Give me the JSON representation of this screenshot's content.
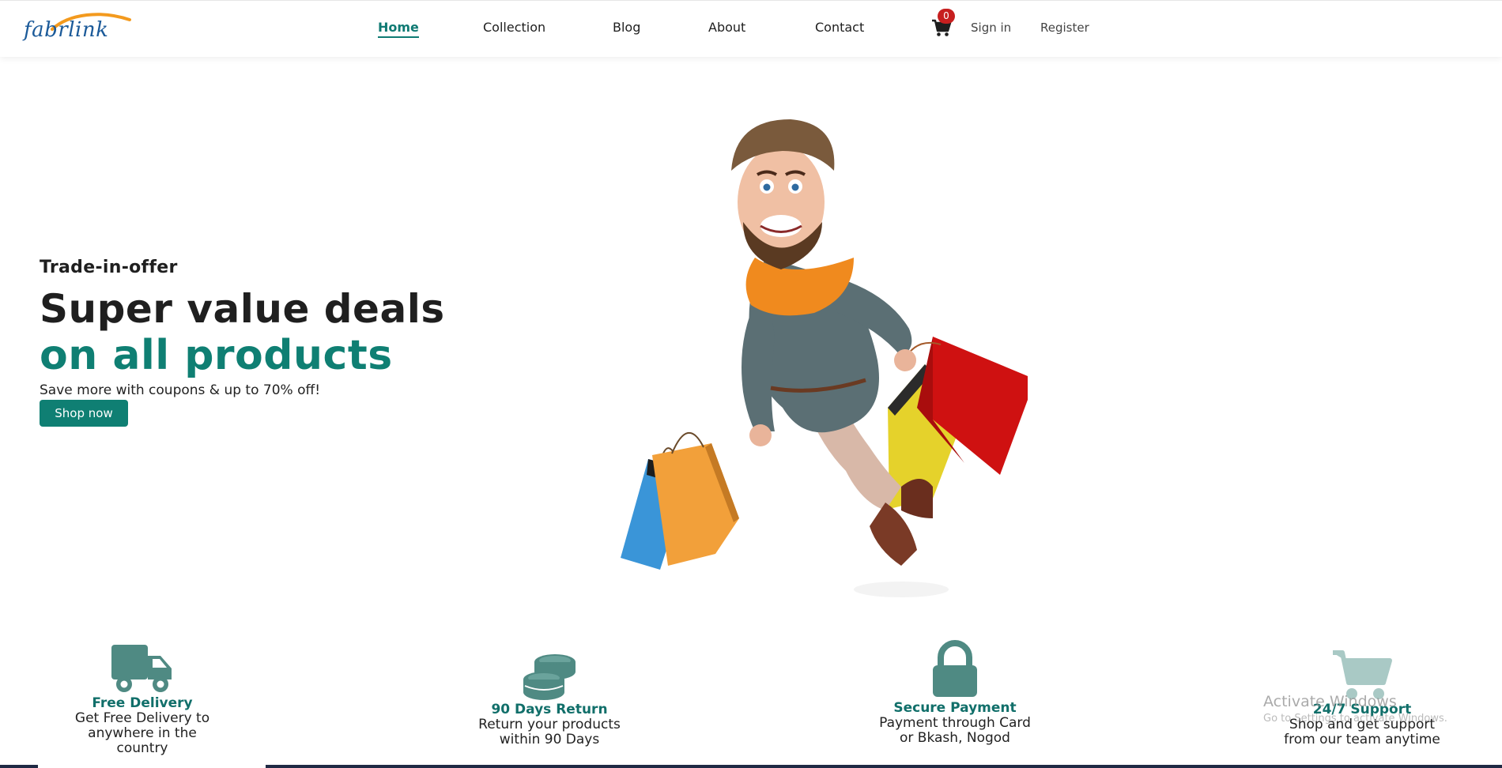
{
  "brand": {
    "logo_text": "fabrlink",
    "accent": "#0f7f73",
    "logo_color": "#1b5a99",
    "logo_arc_color": "#f39a1e"
  },
  "nav": {
    "links": [
      {
        "label": "Home",
        "active": true
      },
      {
        "label": "Collection",
        "active": false
      },
      {
        "label": "Blog",
        "active": false
      },
      {
        "label": "About",
        "active": false
      },
      {
        "label": "Contact",
        "active": false
      }
    ],
    "cart": {
      "icon": "shopping-cart-icon",
      "count": "0",
      "badge_color": "#c71f1f"
    },
    "sign_in": "Sign in",
    "register": "Register"
  },
  "hero": {
    "eyebrow": "Trade-in-offer",
    "title_line1": "Super value deals",
    "title_line2": "on all products",
    "subtitle": "Save more with coupons & up to 70% off!",
    "cta": "Shop now",
    "illustration": "cartoon-man-with-shopping-bags"
  },
  "features": [
    {
      "icon": "truck-icon",
      "title": "Free Delivery",
      "desc": "Get Free Delivery to anywhere in the country"
    },
    {
      "icon": "coins-icon",
      "title": "90 Days Return",
      "desc": "Return your products within 90 Days"
    },
    {
      "icon": "lock-icon",
      "title": "Secure Payment",
      "desc": "Payment through Card or Bkash, Nogod"
    },
    {
      "icon": "shopping-cart-icon",
      "title": "24/7 Support",
      "desc": "Shop and get support from our team anytime"
    }
  ],
  "watermark": {
    "title": "Activate Windows",
    "subtitle": "Go to Settings to activate Windows."
  }
}
